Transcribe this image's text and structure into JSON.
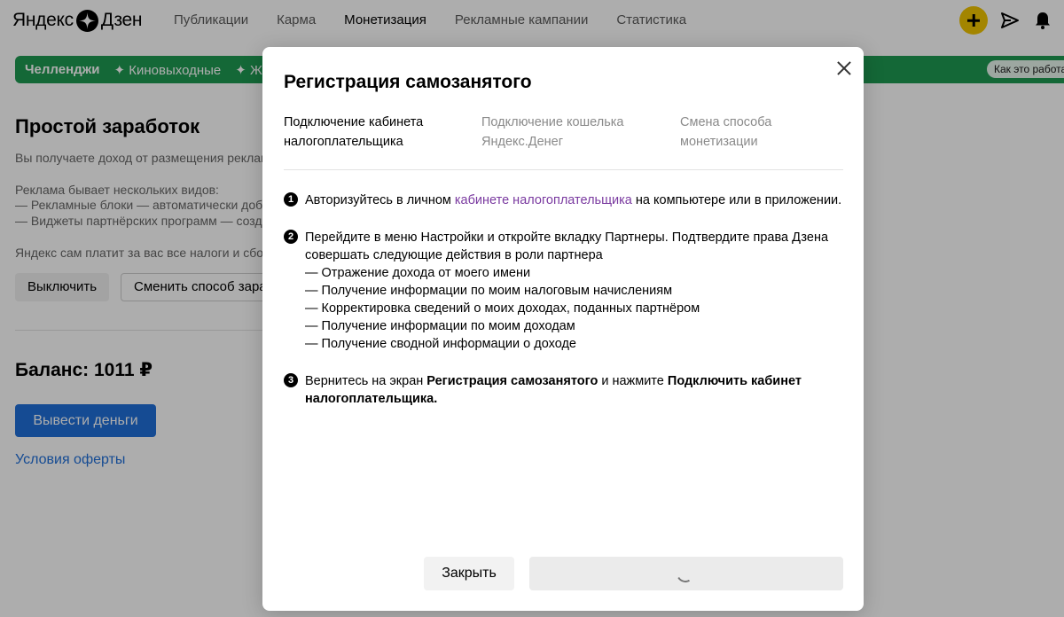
{
  "header": {
    "logo_left": "Яндекс",
    "logo_right": "Дзен",
    "nav": [
      "Публикации",
      "Карма",
      "Монетизация",
      "Рекламные кампании",
      "Статистика"
    ],
    "active_nav": "Монетизация",
    "icons": [
      "plus-icon",
      "send-icon",
      "bell-icon"
    ]
  },
  "challenges": {
    "label": "Челленджи",
    "items": [
      "✦ Киновыходные",
      "✦ Жит"
    ],
    "how_it_works": "Как это работа"
  },
  "main": {
    "title": "Простой заработок",
    "intro": "Вы получаете доход от размещения реклам",
    "ads_kinds": "Реклама бывает нескольких видов:",
    "ads_item_1": "— Рекламные блоки — автоматически доба",
    "ads_item_2": "— Виджеты партнёрских программ — созд",
    "taxes": "Яндекс сам платит за вас все налоги и сбор",
    "btn_disable": "Выключить",
    "btn_change": "Сменить способ зараб",
    "balance": "Баланс: 1011 ₽",
    "btn_withdraw": "Вывести деньги",
    "offer_link": "Условия оферты"
  },
  "modal": {
    "title": "Регистрация самозанятого",
    "steps": [
      {
        "line1": "Подключение кабинета",
        "line2": "налогоплательщика",
        "active": true
      },
      {
        "line1": "Подключение кошелька",
        "line2": "Яндекс.Денег",
        "active": false
      },
      {
        "line1": "Смена способа",
        "line2": "монетизации",
        "active": false
      }
    ],
    "instr1": {
      "num": "1",
      "before": "Авторизуйтесь в личном ",
      "link": "кабинете налогоплательщика",
      "after": " на компьютере или в приложении."
    },
    "instr2": {
      "num": "2",
      "line1": "Перейдите в меню Настройки и откройте вкладку Партнеры. Подтвердите права Дзена",
      "line2": "совершать следующие действия в роли партнера",
      "items": [
        "— Отражение дохода от моего имени",
        "— Получение информации по моим налоговым начислениям",
        "— Корректировка сведений о моих доходах, поданных партнёром",
        "— Получение информации по моим доходам",
        "— Получение сводной информации о доходе"
      ]
    },
    "instr3": {
      "num": "3",
      "pre": "Вернитесь на экран ",
      "bold1": "Регистрация самозанятого",
      "mid": " и нажмите ",
      "bold2": "Подключить кабинет",
      "bold3": "налогоплательщика."
    },
    "btn_close": "Закрыть"
  },
  "colors": {
    "challenge_bar": "#1e9a52",
    "plus_button": "#f0c400",
    "primary_blue": "#1f6fd9",
    "link_purple": "#7a3aa0"
  }
}
